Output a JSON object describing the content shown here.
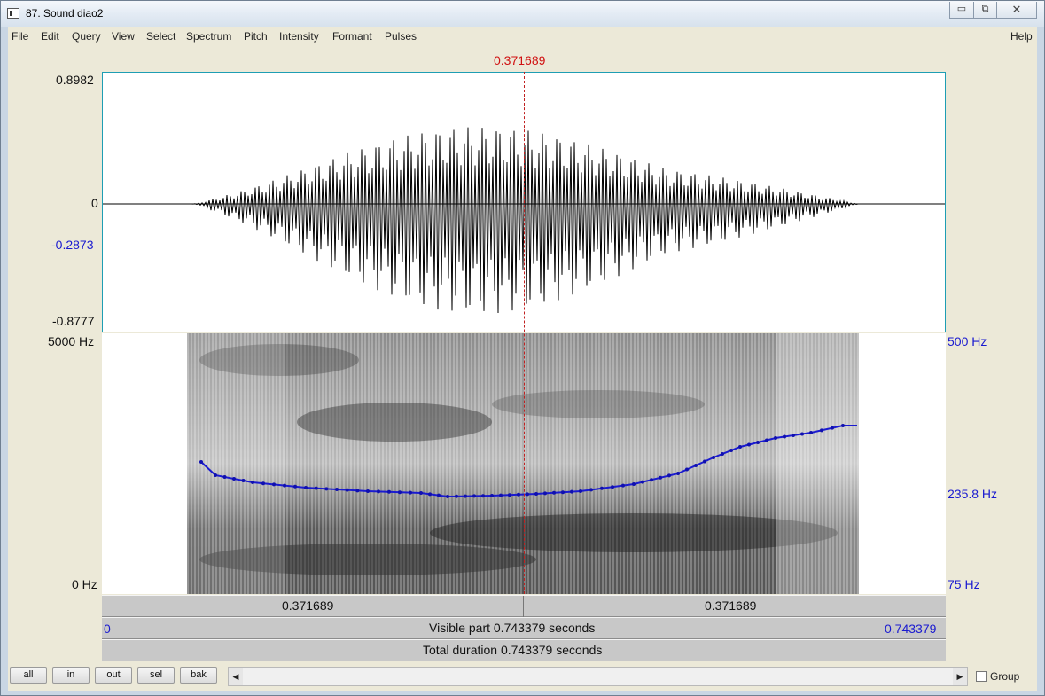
{
  "window": {
    "title": "87. Sound diao2",
    "buttons": [
      "minimize",
      "restore",
      "close"
    ]
  },
  "menu": [
    "File",
    "Edit",
    "Query",
    "View",
    "Select",
    "Spectrum",
    "Pitch",
    "Intensity",
    "Formant",
    "Pulses"
  ],
  "menu_help": "Help",
  "cursor": {
    "time_label": "0.371689",
    "time": 0.371689
  },
  "waveform": {
    "y_max": "0.8982",
    "y_zero": "0",
    "y_cursor": "-0.2873",
    "y_min": "-0.8777"
  },
  "spectrogram": {
    "freq_max": "5000 Hz",
    "freq_min": "0 Hz",
    "pitch_max": "500 Hz",
    "pitch_value": "235.8 Hz",
    "pitch_min": "75 Hz",
    "pitch_color": "#1a1ad0"
  },
  "timebar": {
    "left": "0.371689",
    "right": "0.371689"
  },
  "visible": {
    "start": "0",
    "label": "Visible part 0.743379 seconds",
    "end": "0.743379"
  },
  "total": {
    "label": "Total duration 0.743379 seconds"
  },
  "buttons": [
    "all",
    "in",
    "out",
    "sel",
    "bak"
  ],
  "group": {
    "label": "Group",
    "checked": false
  }
}
